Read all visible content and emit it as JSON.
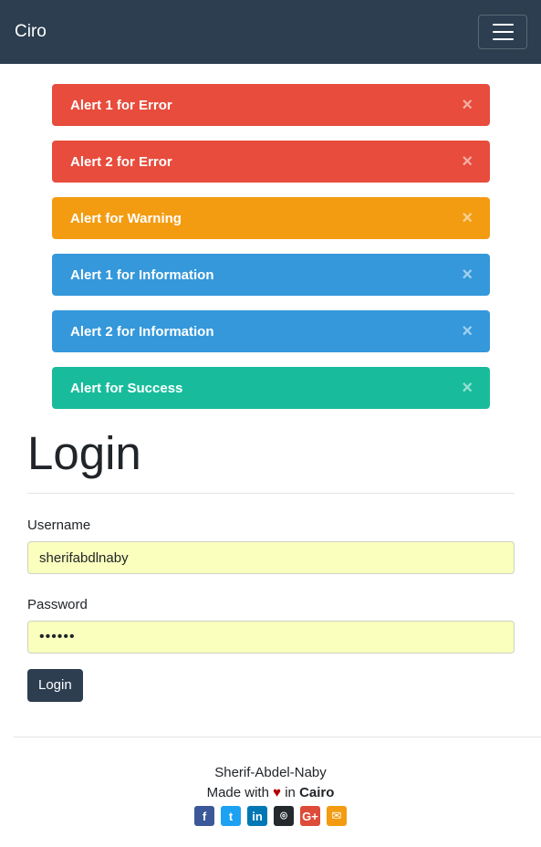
{
  "navbar": {
    "brand": "Ciro"
  },
  "alerts": [
    {
      "text": "Alert 1 for Error",
      "color": "#e74c3c"
    },
    {
      "text": "Alert 2 for Error",
      "color": "#e74c3c"
    },
    {
      "text": "Alert for Warning",
      "color": "#f39c12"
    },
    {
      "text": "Alert 1 for Information",
      "color": "#3498db"
    },
    {
      "text": "Alert 2 for Information",
      "color": "#3498db"
    },
    {
      "text": "Alert for Success",
      "color": "#18bc9c"
    }
  ],
  "alert_close": "×",
  "login": {
    "title": "Login",
    "username_label": "Username",
    "username_value": "sherifabdlnaby",
    "password_label": "Password",
    "password_value": "••••••",
    "button": "Login"
  },
  "footer": {
    "author": "Sherif-Abdel-Naby",
    "made_with": "Made with",
    "heart": "♥",
    "in": "in",
    "city": "Cairo",
    "social": [
      {
        "icon": "facebook-icon",
        "glyph": "f",
        "color": "#3b5998"
      },
      {
        "icon": "twitter-icon",
        "glyph": "t",
        "color": "#1da1f2"
      },
      {
        "icon": "linkedin-icon",
        "glyph": "in",
        "color": "#0077b5"
      },
      {
        "icon": "github-icon",
        "glyph": "⌾",
        "color": "#24292e"
      },
      {
        "icon": "google-plus-icon",
        "glyph": "G+",
        "color": "#dd4b39"
      },
      {
        "icon": "email-icon",
        "glyph": "✉",
        "color": "#f39c12"
      }
    ]
  },
  "colors": {
    "navbar": "#2c3e50",
    "field_bg": "#faffbd"
  }
}
